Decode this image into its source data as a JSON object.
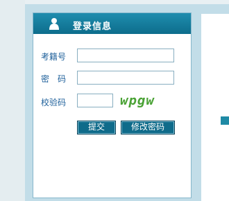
{
  "login": {
    "title": "登录信息",
    "exam_id_label": "考籍号",
    "password_label": "密　码",
    "captcha_label": "校验码",
    "exam_id_value": "",
    "password_value": "",
    "captcha_value": "",
    "captcha_text": "wpgw",
    "submit_label": "提交",
    "change_password_label": "修改密码"
  },
  "colors": {
    "header": "#1f8dae",
    "label_text": "#1d5f9a",
    "button": "#0f6b8a",
    "captcha": "#4aa235",
    "background": "#c2dde8"
  },
  "icons": {
    "header_icon": "user-icon"
  }
}
